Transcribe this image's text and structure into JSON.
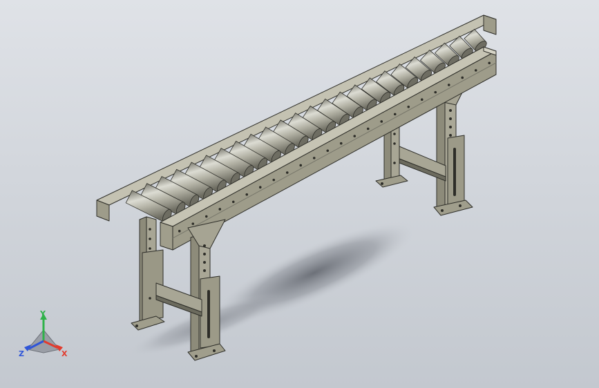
{
  "model": {
    "roller_count": 24,
    "colors": {
      "frame": "#9e9c8a",
      "frame_dark": "#5b5a4f",
      "frame_light": "#c4c2b2",
      "roller": "#b4b3a6",
      "roller_light": "#dcdcd3",
      "roller_dark": "#6e6d62",
      "edge": "#2d2d28",
      "shadow": "#6f737b"
    }
  },
  "triad": {
    "x_label": "X",
    "y_label": "Y",
    "z_label": "Z",
    "x_color": "#e23b2e",
    "y_color": "#2fb24a",
    "z_color": "#2f55d8"
  }
}
